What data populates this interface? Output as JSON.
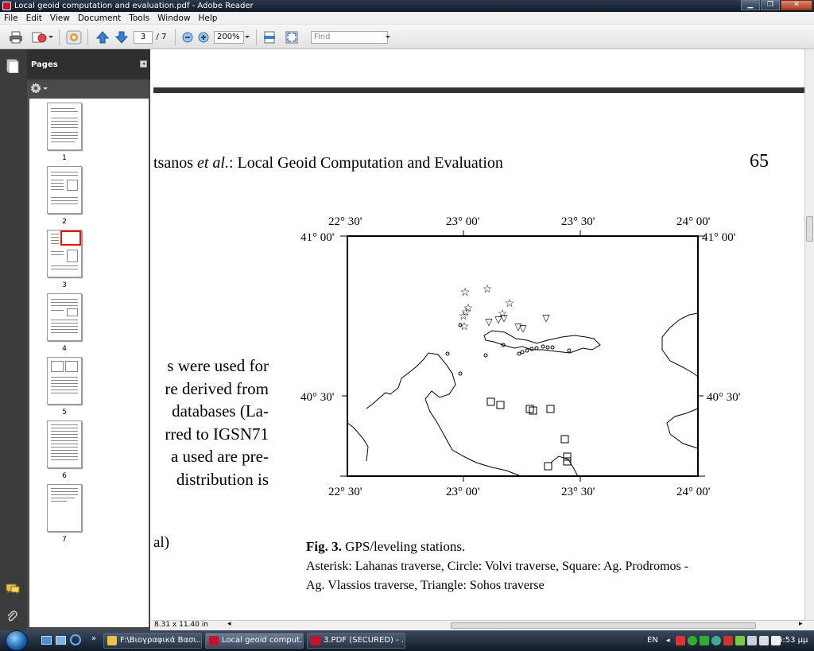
{
  "window": {
    "title": "Local geoid computation and evaluation.pdf - Adobe Reader"
  },
  "menu": [
    "File",
    "Edit",
    "View",
    "Document",
    "Tools",
    "Window",
    "Help"
  ],
  "toolbar": {
    "page_current": "3",
    "page_total": "/ 7",
    "zoom": "200%",
    "find_placeholder": "Find"
  },
  "pages_panel": {
    "title": "Pages",
    "thumbnails": [
      {
        "label": "1"
      },
      {
        "label": "2"
      },
      {
        "label": "3"
      },
      {
        "label": "4"
      },
      {
        "label": "5"
      },
      {
        "label": "6"
      },
      {
        "label": "7"
      }
    ],
    "selected": "3"
  },
  "status": {
    "page_size": "8.31 x 11.40 in"
  },
  "document": {
    "header": {
      "author": "tsanos ",
      "etal": "et al.",
      "title": ": Local Geoid Computation and Evaluation"
    },
    "page_number": "65",
    "body_lines": [
      "s were used for",
      "re derived from",
      "databases (La-",
      "rred to IGSN71",
      "a used are pre-",
      "distribution is",
      "al)"
    ],
    "figure": {
      "lon_labels": [
        "22° 30'",
        "23° 00'",
        "23° 30'",
        "24° 00'"
      ],
      "lat_top_labels": [
        "41° 00'",
        "41° 00'"
      ],
      "lat_mid_labels": [
        "40° 30'",
        "40° 30'"
      ],
      "caption_bold": "Fig. 3.",
      "caption_title": " GPS/leveling stations.",
      "caption_line2": "Asterisk: Lahanas traverse, Circle: Volvi traverse, Square: Ag. Prodromos -",
      "caption_line3": "Ag. Vlassios traverse, Triangle: Sohos traverse"
    }
  },
  "taskbar": {
    "tasks": [
      {
        "label": "F:\\Βιογραφικά Βασι...",
        "color": "#e8c34a"
      },
      {
        "label": "Local geoid comput...",
        "color": "#c8102e"
      },
      {
        "label": "3.PDF (SECURED) - ...",
        "color": "#c8102e"
      }
    ],
    "language": "EN",
    "clock": "6:53 μμ"
  }
}
